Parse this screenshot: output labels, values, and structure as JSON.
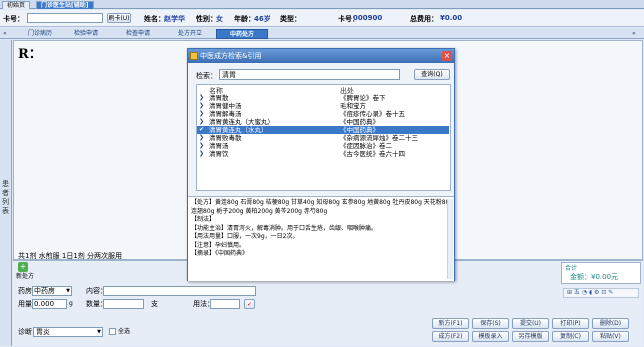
{
  "top_tabs": {
    "items": [
      "初始页",
      "门诊医生站[辅助]"
    ]
  },
  "patient": {
    "card_label": "卡号：",
    "refresh_label": "刷卡(U)",
    "name_label": "姓名：",
    "name_value": "赵学华",
    "sex_label": "性别：",
    "sex_value": "女",
    "age_label": "年龄：",
    "age_value": "46岁",
    "type_label": "类型：",
    "card2_label": "卡号：",
    "card2_value": "000900",
    "total_label": "总费用：",
    "total_value": "¥0.00"
  },
  "sub_tabs": {
    "items": [
      "门诊病历",
      "检验申请",
      "检查申请",
      "处方开立",
      "中药处方"
    ],
    "active_index": 4
  },
  "side_tab": {
    "label": "患者列表"
  },
  "main": {
    "r_symbol": "R：",
    "usage_text": "共1剂  水煎服  1日1剂  分两次服用"
  },
  "lower": {
    "new_rx_label": "新处方",
    "pharmacy_label": "药房：",
    "pharmacy_value": "中药房",
    "content_label": "内容：",
    "dose_label": "用量：",
    "dose_value": "0.000",
    "dose_unit": "g",
    "qty_label": "数量：",
    "qty_unit": "支",
    "method_label": "用法：",
    "diag_label": "诊断：",
    "diag_value": "胃炎",
    "select_all_label": "全选",
    "total_title": "合计",
    "amount_label": "金额：",
    "amount_value": "¥0.00元"
  },
  "actions": {
    "row1": [
      "新方(F1)",
      "保存(S)",
      "提交(U)",
      "打印(P)",
      "删除(D)"
    ],
    "row2": [
      "成方(F2)",
      "模板录入",
      "另存模版",
      "复制(C)",
      "粘贴(V)"
    ]
  },
  "dialog": {
    "title": "中医成方检索&引用",
    "close": "×",
    "search_label": "检索：",
    "search_value": "清胃",
    "query_button": "查询(Q)",
    "col_name": "名称",
    "col_source": "出处",
    "rows": [
      {
        "name": "清胃散",
        "source": "《脾胃论》卷下"
      },
      {
        "name": "清胃健中汤",
        "source": "毛和宝方"
      },
      {
        "name": "清胃解毒汤",
        "source": "《痘疹传心录》卷十五"
      },
      {
        "name": "清胃黄连丸（大蜜丸）",
        "source": "《中国药典》"
      },
      {
        "name": "清胃黄连丸（水丸）",
        "source": "《中国药典》"
      },
      {
        "name": "清胃败毒散",
        "source": "《杂病源流犀烛》卷二十三"
      },
      {
        "name": "清胃汤",
        "source": "《症因脉治》卷二"
      },
      {
        "name": "清胃饮",
        "source": "《古今医统》卷六十四"
      }
    ],
    "selected_index": 4,
    "detail_lines": [
      "【处方】黄连80g  石膏80g  桔梗80g  甘草40g  知母80g  玄参80g  地黄80g  牡丹皮80g  天花粉80g",
      "连翘80g  栀子200g  黄柏200g  黄芩200g  赤芍80g",
      "【制法】",
      "【功能主治】清胃泻火，解毒消肿。用于口舌生疮，齿龈、咽喉肿痛。",
      "【用法用量】口服，一次9g，一日2次。",
      "【注意】孕妇慎用。",
      "【摘录】《中国药典》"
    ]
  }
}
